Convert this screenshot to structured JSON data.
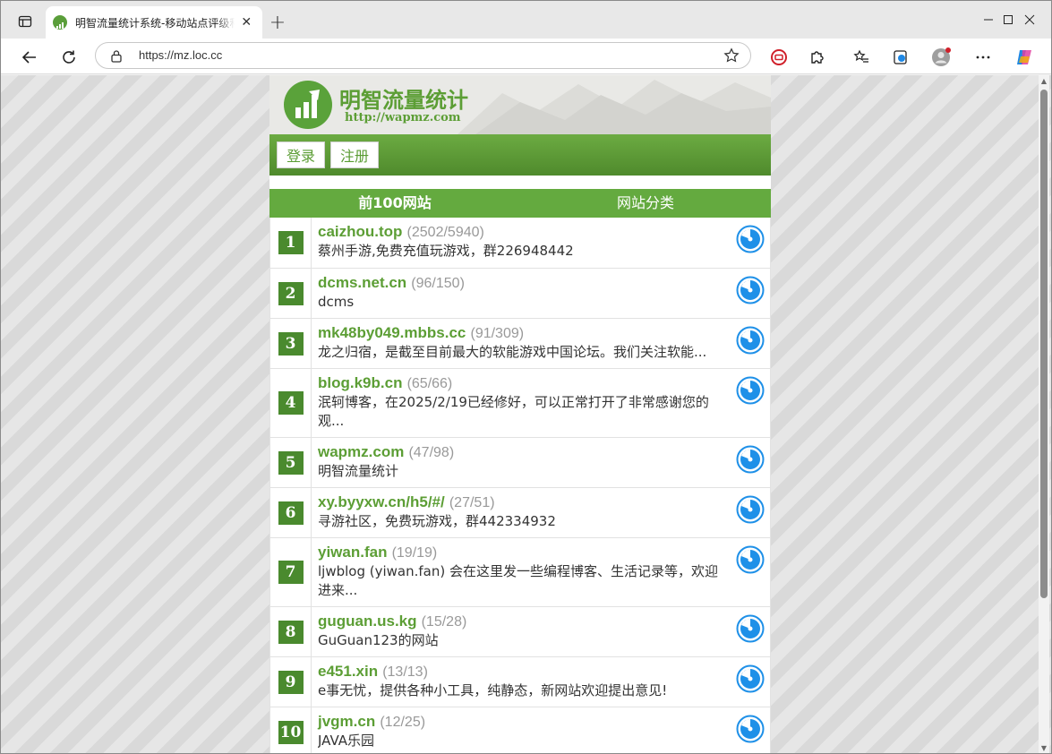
{
  "browser": {
    "tab_title": "明智流量统计系统-移动站点评级和",
    "url": "https://mz.loc.cc"
  },
  "site": {
    "brand": "明智流量统计",
    "site_url": "http://wapmz.com",
    "brand_color": "#5c9e35"
  },
  "auth": {
    "login": "登录",
    "register": "注册"
  },
  "tabs": [
    {
      "label": "前100网站",
      "active": true
    },
    {
      "label": "网站分类",
      "active": false
    }
  ],
  "rows": [
    {
      "rank": "1",
      "domain": "caizhou.top",
      "stats": "(2502/5940)",
      "desc": "蔡州手游,免费充值玩游戏，群226948442"
    },
    {
      "rank": "2",
      "domain": "dcms.net.cn",
      "stats": "(96/150)",
      "desc": "dcms"
    },
    {
      "rank": "3",
      "domain": "mk48by049.mbbs.cc",
      "stats": "(91/309)",
      "desc": "龙之归宿，是截至目前最大的软能游戏中国论坛。我们关注软能..."
    },
    {
      "rank": "4",
      "domain": "blog.k9b.cn",
      "stats": "(65/66)",
      "desc": "泯轲博客，在2025/2/19已经修好，可以正常打开了非常感谢您的观..."
    },
    {
      "rank": "5",
      "domain": "wapmz.com",
      "stats": "(47/98)",
      "desc": "明智流量统计"
    },
    {
      "rank": "6",
      "domain": "xy.byyxw.cn/h5/#/",
      "stats": "(27/51)",
      "desc": "寻游社区，免费玩游戏，群442334932"
    },
    {
      "rank": "7",
      "domain": "yiwan.fan",
      "stats": "(19/19)",
      "desc": "ljwblog (yiwan.fan) 会在这里发一些编程博客、生活记录等，欢迎进来..."
    },
    {
      "rank": "8",
      "domain": "guguan.us.kg",
      "stats": "(15/28)",
      "desc": "GuGuan123的网站"
    },
    {
      "rank": "9",
      "domain": "e451.xin",
      "stats": "(13/13)",
      "desc": "e事无忧，提供各种小工具，纯静态，新网站欢迎提出意见!"
    },
    {
      "rank": "10",
      "domain": "jvgm.cn",
      "stats": "(12/25)",
      "desc": "JAVA乐园"
    }
  ],
  "icons": {
    "row_icon": "chart-disc-icon",
    "row_icon_color": "#1e90e8"
  }
}
